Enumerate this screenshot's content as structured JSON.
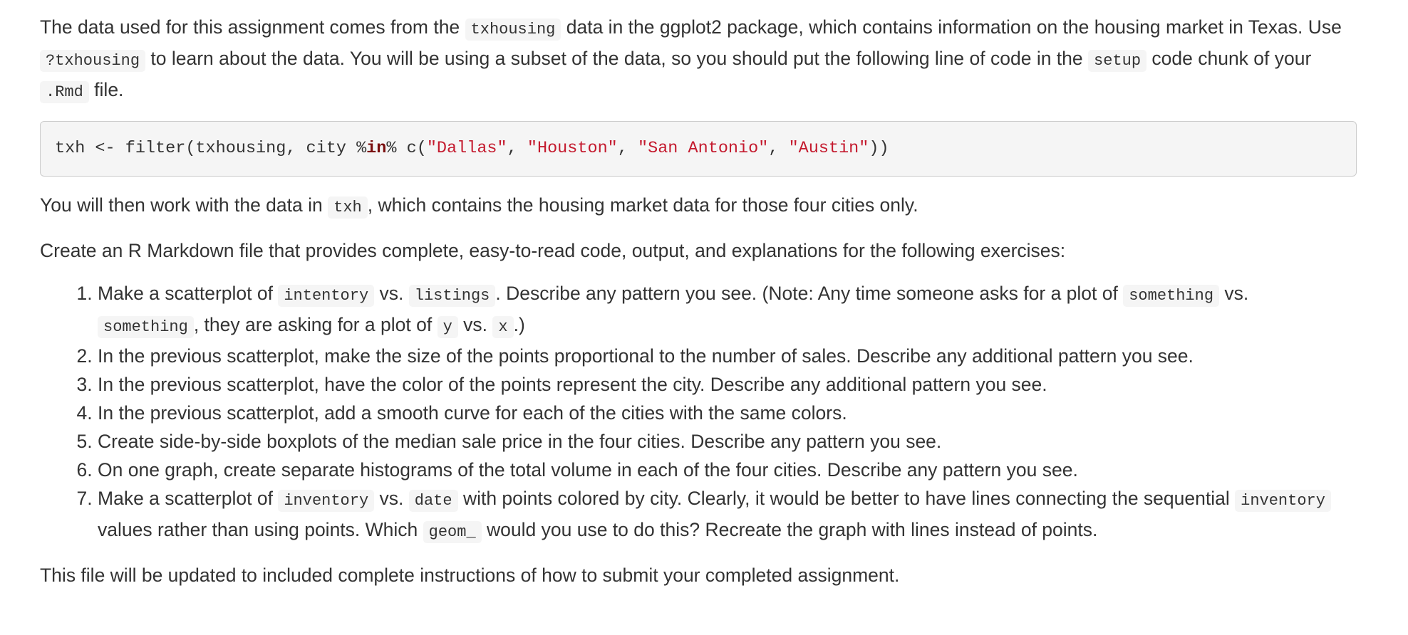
{
  "intro": {
    "p1": [
      "The data used for this assignment comes from the ",
      "txhousing",
      " data in the ggplot2 package, which contains information on the housing market in Texas. Use ",
      "?txhousing",
      " to learn about the data. You will be using a subset of the data, so you should put the following line of code in the ",
      "setup",
      " code chunk of your ",
      ".Rmd",
      " file."
    ]
  },
  "code_chunk": {
    "parts": [
      "txh <- filter(txhousing, city %",
      "in",
      "% c(",
      "\"Dallas\"",
      ", ",
      "\"Houston\"",
      ", ",
      "\"San Antonio\"",
      ", ",
      "\"Austin\"",
      "))"
    ]
  },
  "p2": [
    "You will then work with the data in ",
    "txh",
    ", which contains the housing market data for those four cities only."
  ],
  "p3": "Create an R Markdown file that provides complete, easy-to-read code, output, and explanations for the following exercises:",
  "exercises": [
    [
      "Make a scatterplot of ",
      "intentory",
      " vs. ",
      "listings",
      ". Describe any pattern you see. (Note: Any time someone asks for a plot of ",
      "something",
      " vs. ",
      "something",
      ", they are asking for a plot of ",
      "y",
      " vs. ",
      "x",
      ".)"
    ],
    [
      "In the previous scatterplot, make the size of the points proportional to the number of sales. Describe any additional pattern you see."
    ],
    [
      "In the previous scatterplot, have the color of the points represent the city. Describe any additional pattern you see."
    ],
    [
      "In the previous scatterplot, add a smooth curve for each of the cities with the same colors."
    ],
    [
      "Create side-by-side boxplots of the median sale price in the four cities. Describe any pattern you see."
    ],
    [
      "On one graph, create separate histograms of the total volume in each of the four cities. Describe any pattern you see."
    ],
    [
      "Make a scatterplot of ",
      "inventory",
      " vs. ",
      "date",
      " with points colored by city. Clearly, it would be better to have lines connecting the sequential ",
      "inventory",
      " values rather than using points. Which ",
      "geom_",
      " would you use to do this? Recreate the graph with lines instead of points."
    ]
  ],
  "p4": "This file will be updated to included complete instructions of how to submit your completed assignment.",
  "colors": {
    "text": "#333333",
    "code_bg": "#f5f5f5",
    "keyword": "#7a0e0e",
    "string": "#c41a2e"
  }
}
